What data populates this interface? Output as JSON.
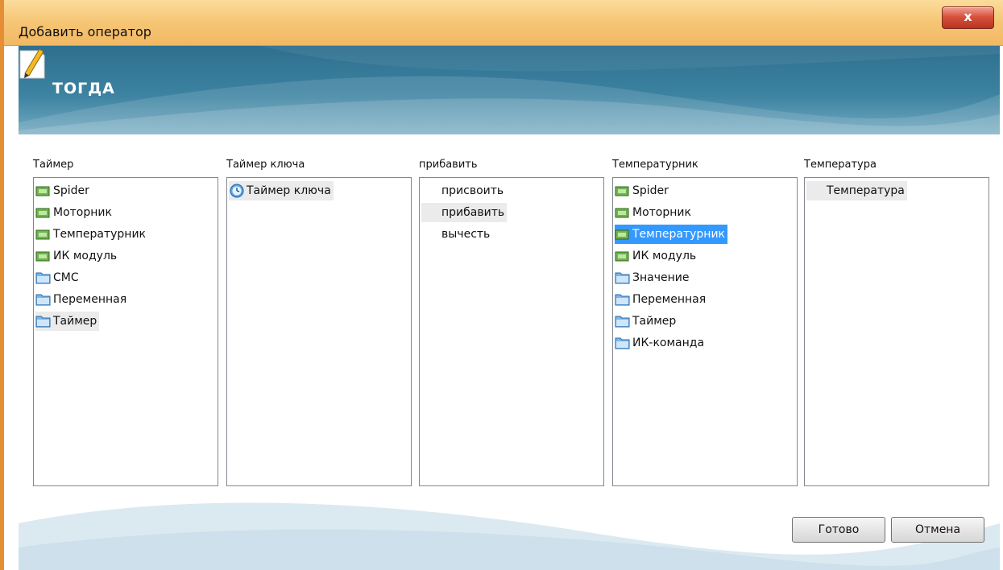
{
  "window": {
    "title": "Добавить оператор",
    "close_label": "x"
  },
  "banner": {
    "title": "ТОГДА"
  },
  "columns": [
    {
      "label": "Таймер",
      "items": [
        {
          "icon": "device-icon",
          "text": "Spider"
        },
        {
          "icon": "device-icon",
          "text": "Моторник"
        },
        {
          "icon": "device-icon",
          "text": "Температурник"
        },
        {
          "icon": "device-icon",
          "text": "ИК модуль"
        },
        {
          "icon": "folder-icon",
          "text": "СМС"
        },
        {
          "icon": "folder-icon",
          "text": "Переменная"
        },
        {
          "icon": "folder-icon",
          "text": "Таймер",
          "selected": "grey"
        }
      ]
    },
    {
      "label": "Таймер ключа",
      "items": [
        {
          "icon": "clock-icon",
          "text": "Таймер ключа",
          "selected": "grey"
        }
      ]
    },
    {
      "label": "прибавить",
      "items": [
        {
          "icon": "",
          "text": "присвоить"
        },
        {
          "icon": "",
          "text": "прибавить",
          "selected": "grey"
        },
        {
          "icon": "",
          "text": "вычесть"
        }
      ]
    },
    {
      "label": "Температурник",
      "items": [
        {
          "icon": "device-icon",
          "text": "Spider"
        },
        {
          "icon": "device-icon",
          "text": "Моторник"
        },
        {
          "icon": "device-icon",
          "text": "Температурник",
          "selected": "blue"
        },
        {
          "icon": "device-icon",
          "text": "ИК модуль"
        },
        {
          "icon": "folder-icon",
          "text": "Значение"
        },
        {
          "icon": "folder-icon",
          "text": "Переменная"
        },
        {
          "icon": "folder-icon",
          "text": "Таймер"
        },
        {
          "icon": "folder-icon",
          "text": "ИК-команда"
        }
      ]
    },
    {
      "label": "Температура",
      "items": [
        {
          "icon": "",
          "text": "Температура",
          "selected": "grey"
        }
      ]
    }
  ],
  "buttons": {
    "ok_label": "Готово",
    "cancel_label": "Отмена"
  },
  "colors": {
    "banner": "#3c82a1",
    "selection_blue": "#3399ff",
    "titlebar": "#f6c777"
  }
}
